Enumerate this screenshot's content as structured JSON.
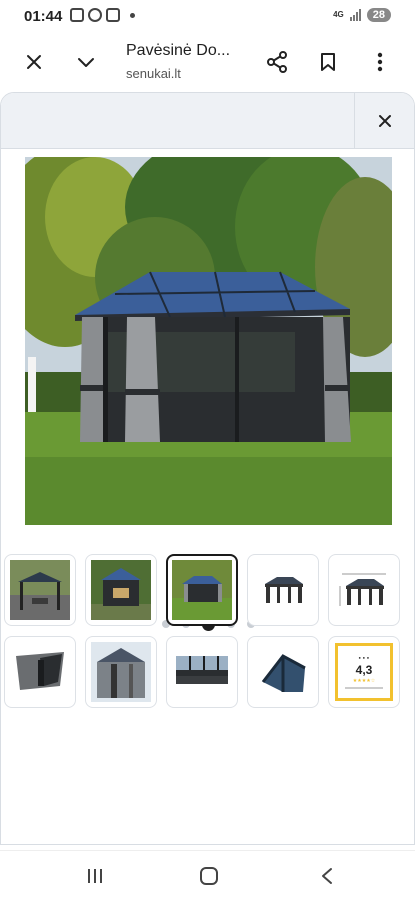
{
  "status_bar": {
    "time": "01:44",
    "network": "4G",
    "battery": "28"
  },
  "header": {
    "title": "Pavėsinė Do...",
    "domain": "senukai.lt"
  },
  "carousel": {
    "total": 5,
    "active_index": 2
  },
  "thumbnails": [
    {
      "name": "thumbnail-gazebo-patio-dining"
    },
    {
      "name": "thumbnail-gazebo-garden-front"
    },
    {
      "name": "thumbnail-gazebo-lawn",
      "selected": true
    },
    {
      "name": "thumbnail-gazebo-frame-white"
    },
    {
      "name": "thumbnail-gazebo-dimensions"
    },
    {
      "name": "thumbnail-curtain-detail"
    },
    {
      "name": "thumbnail-roof-corner"
    },
    {
      "name": "thumbnail-roof-panel"
    },
    {
      "name": "thumbnail-frame-corner"
    },
    {
      "name": "thumbnail-rating-badge"
    }
  ],
  "rating_badge": {
    "score": "4,3"
  },
  "colors": {
    "panel_top": "#eef1f5",
    "roof_blue": "#3b5f9a",
    "mesh": "#2a2d30",
    "grass": "#5b8a2e",
    "badge_border": "#f2c12e"
  }
}
